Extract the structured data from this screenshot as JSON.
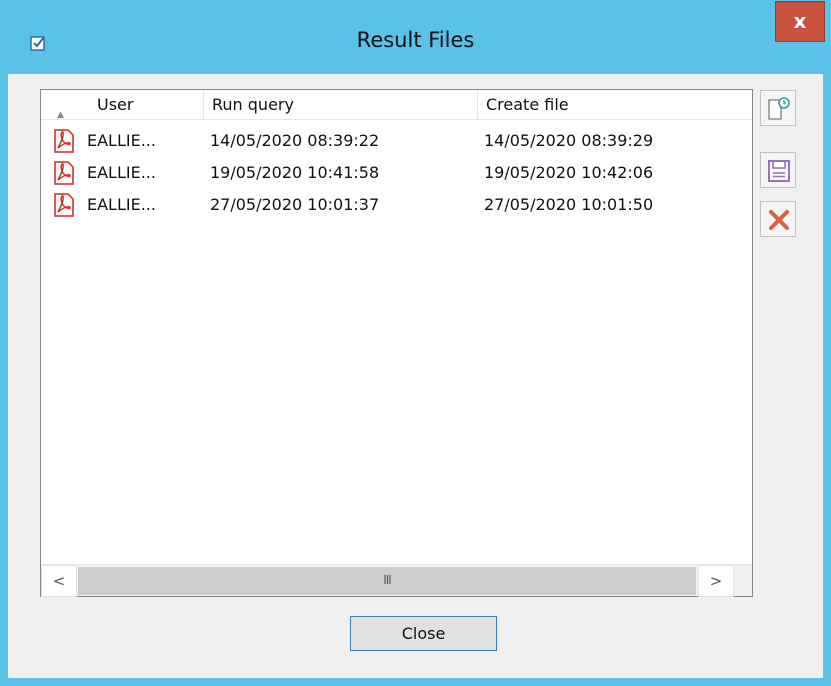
{
  "window": {
    "title": "Result Files",
    "close_glyph": "x",
    "app_icon": "checkmark-box-icon"
  },
  "list": {
    "columns": [
      "User",
      "Run query",
      "Create file"
    ],
    "sort_indicator": "▲",
    "rows": [
      {
        "icon": "pdf-file-icon",
        "user": "EALLIE...",
        "run_query": "14/05/2020 08:39:22",
        "create_file": "14/05/2020 08:39:29"
      },
      {
        "icon": "pdf-file-icon",
        "user": "EALLIE...",
        "run_query": "19/05/2020 10:41:58",
        "create_file": "19/05/2020 10:42:06"
      },
      {
        "icon": "pdf-file-icon",
        "user": "EALLIE...",
        "run_query": "27/05/2020 10:01:37",
        "create_file": "27/05/2020 10:01:50"
      }
    ],
    "scrollbar": {
      "left_arrow": "<",
      "right_arrow": ">",
      "thumb_grip": "III"
    }
  },
  "side_toolbar": [
    {
      "name": "open-file-button",
      "icon": "open-file-icon"
    },
    {
      "name": "save-button",
      "icon": "floppy-disk-icon"
    },
    {
      "name": "delete-button",
      "icon": "delete-x-icon"
    }
  ],
  "footer": {
    "close_label": "Close"
  },
  "colors": {
    "titlebar": "#5bc2e7",
    "close_button": "#c9523f",
    "pdf_red": "#d0271d",
    "save_purple": "#9a6fc1",
    "delete_red": "#d9603e",
    "open_green": "#2aa198"
  }
}
